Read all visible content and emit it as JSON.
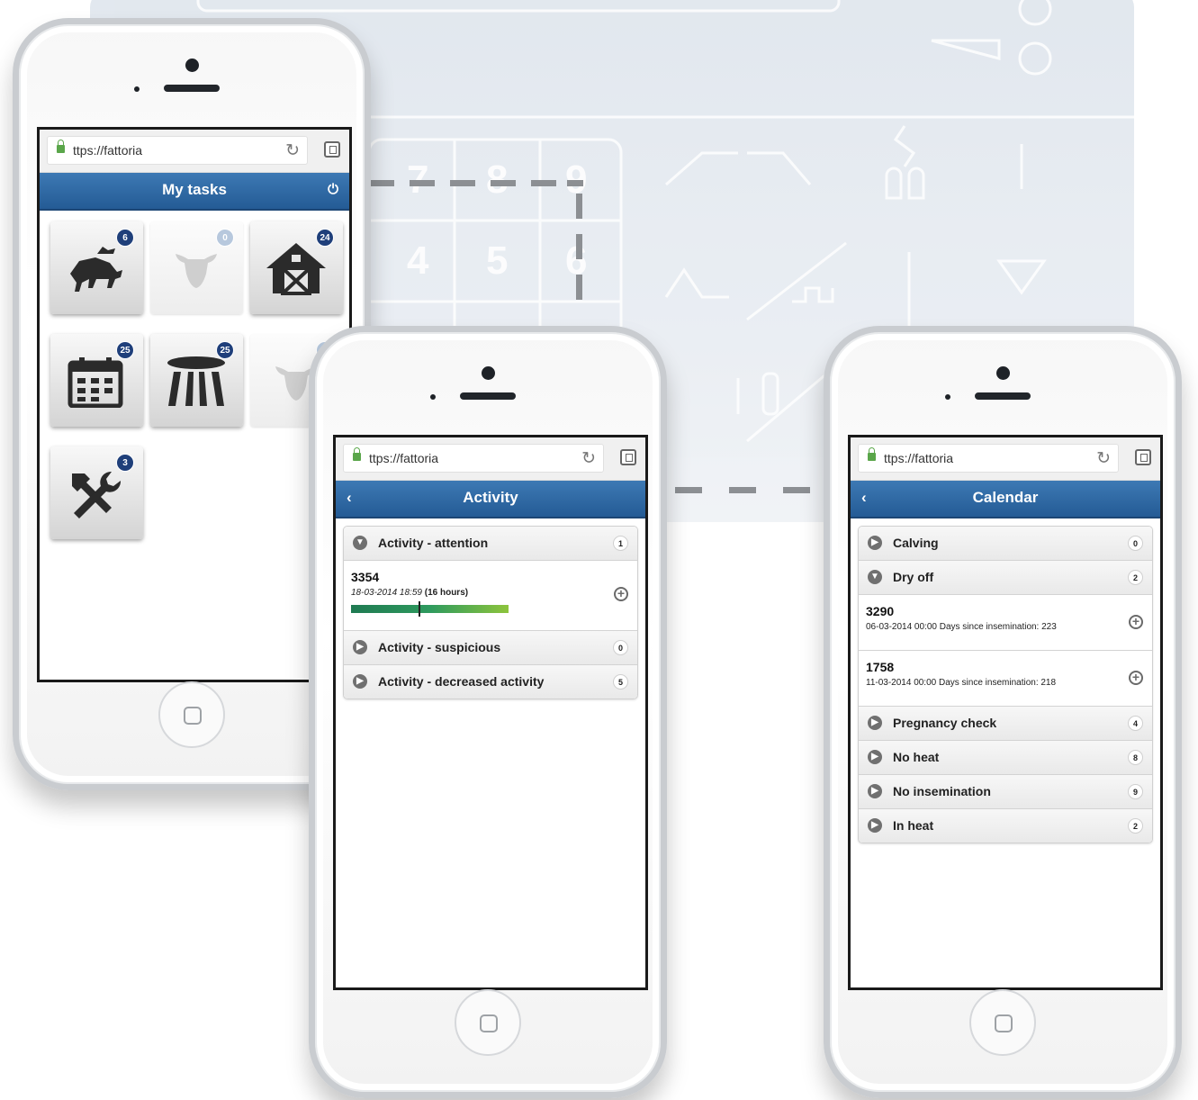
{
  "background": {
    "keypad_numbers": [
      "7",
      "8",
      "9",
      "4",
      "5",
      "6"
    ]
  },
  "phone1": {
    "url": "ttps://fattoria",
    "title": "My tasks",
    "tiles": [
      {
        "name": "breeding",
        "icon": "cows-mating-icon",
        "badge": "6",
        "enabled": true
      },
      {
        "name": "cow",
        "icon": "cow-head-icon",
        "badge": "0",
        "enabled": false
      },
      {
        "name": "barn",
        "icon": "barn-icon",
        "badge": "24",
        "enabled": true
      },
      {
        "name": "calendar",
        "icon": "calendar-icon",
        "badge": "25",
        "enabled": true
      },
      {
        "name": "milking",
        "icon": "milking-unit-icon",
        "badge": "25",
        "enabled": true
      },
      {
        "name": "cow-2",
        "icon": "cow-head-icon",
        "badge": "0",
        "enabled": false
      },
      {
        "name": "maintenance",
        "icon": "tools-icon",
        "badge": "3",
        "enabled": true
      }
    ]
  },
  "phone2": {
    "url": "ttps://fattoria",
    "title": "Activity",
    "groups": [
      {
        "label": "Activity - attention",
        "count": "1",
        "expanded": true
      },
      {
        "label": "Activity - suspicious",
        "count": "0",
        "expanded": false
      },
      {
        "label": "Activity - decreased activity",
        "count": "5",
        "expanded": false
      }
    ],
    "item": {
      "id": "3354",
      "date": "18-03-2014 18:59",
      "duration": "(16 hours)",
      "activity_level": 0.43
    }
  },
  "phone3": {
    "url": "ttps://fattoria",
    "title": "Calendar",
    "groups": [
      {
        "label": "Calving",
        "count": "0"
      },
      {
        "label": "Dry off",
        "count": "2"
      },
      {
        "label": "Pregnancy check",
        "count": "4"
      },
      {
        "label": "No heat",
        "count": "8"
      },
      {
        "label": "No insemination",
        "count": "9"
      },
      {
        "label": "In heat",
        "count": "2"
      }
    ],
    "items": [
      {
        "id": "3290",
        "detail": "06-03-2014 00:00 Days since insemination: 223"
      },
      {
        "id": "1758",
        "detail": "11-03-2014 00:00 Days since insemination: 218"
      }
    ]
  },
  "colors": {
    "header_blue": "#2d69a6",
    "badge_navy": "#1f3f7a",
    "activity_green": "#2e9a5e"
  }
}
